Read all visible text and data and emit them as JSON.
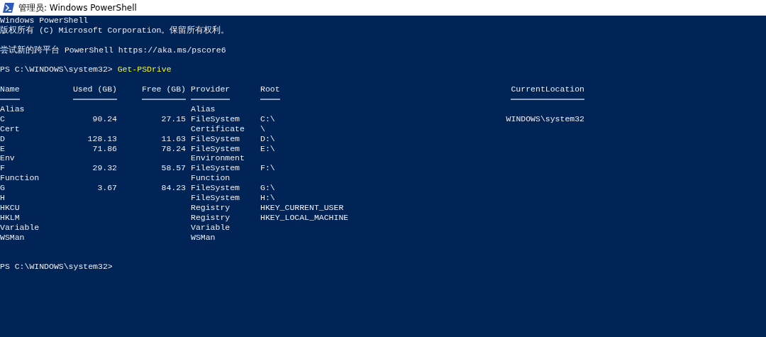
{
  "window": {
    "title": "管理员: Windows PowerShell"
  },
  "console": {
    "banner": [
      "Windows PowerShell",
      "版权所有 (C) Microsoft Corporation。保留所有权利。"
    ],
    "notice": "尝试新的跨平台 PowerShell https://aka.ms/pscore6",
    "command": {
      "prompt": "PS C:\\WINDOWS\\system32>",
      "text": "Get-PSDrive"
    },
    "table": {
      "columns": [
        "Name",
        "Used (GB)",
        "Free (GB)",
        "Provider",
        "Root",
        "CurrentLocation"
      ],
      "rows": [
        {
          "name": "Alias",
          "provider": "Alias"
        },
        {
          "name": "C",
          "used": "90.24",
          "free": "27.15",
          "provider": "FileSystem",
          "root": "C:\\",
          "current_location": "WINDOWS\\system32"
        },
        {
          "name": "Cert",
          "provider": "Certificate",
          "root": "\\"
        },
        {
          "name": "D",
          "used": "128.13",
          "free": "11.63",
          "provider": "FileSystem",
          "root": "D:\\"
        },
        {
          "name": "E",
          "used": "71.86",
          "free": "78.24",
          "provider": "FileSystem",
          "root": "E:\\"
        },
        {
          "name": "Env",
          "provider": "Environment"
        },
        {
          "name": "F",
          "used": "29.32",
          "free": "58.57",
          "provider": "FileSystem",
          "root": "F:\\"
        },
        {
          "name": "Function",
          "provider": "Function"
        },
        {
          "name": "G",
          "used": "3.67",
          "free": "84.23",
          "provider": "FileSystem",
          "root": "G:\\"
        },
        {
          "name": "H",
          "provider": "FileSystem",
          "root": "H:\\"
        },
        {
          "name": "HKCU",
          "provider": "Registry",
          "root": "HKEY_CURRENT_USER"
        },
        {
          "name": "HKLM",
          "provider": "Registry",
          "root": "HKEY_LOCAL_MACHINE"
        },
        {
          "name": "Variable",
          "provider": "Variable"
        },
        {
          "name": "WSMan",
          "provider": "WSMan"
        }
      ]
    },
    "prompt": "PS C:\\WINDOWS\\system32>"
  }
}
